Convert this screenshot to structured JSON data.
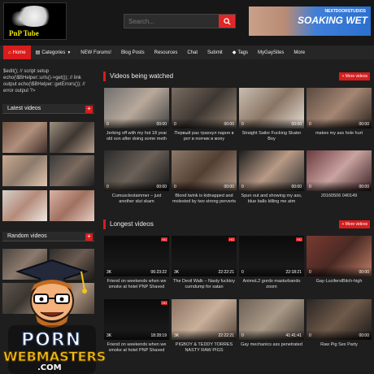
{
  "header": {
    "logo_text": "PnP Tube",
    "search_placeholder": "Search...",
    "banner_top": "NEXTDOORSTUDIOS",
    "banner_main": "SOAKING WET"
  },
  "nav": [
    {
      "label": "Home",
      "icon": "home-icon"
    },
    {
      "label": "Categories",
      "icon": "folder-icon"
    },
    {
      "label": "NEW Forums!"
    },
    {
      "label": "Blog Posts"
    },
    {
      "label": "Resources"
    },
    {
      "label": "Chat"
    },
    {
      "label": "Submit"
    },
    {
      "label": "Tags",
      "icon": "tag-icon"
    },
    {
      "label": "MyGaySites"
    },
    {
      "label": "More"
    }
  ],
  "sidebar": {
    "code_snippet": "$edit(); // script setup echo(\\$BHelper::urls()->get()); // link output echo(\\$BHelper::getErrors()); // error output ?>",
    "latest_title": "Latest videos",
    "random_title": "Random videos",
    "plus_label": "+"
  },
  "watching": {
    "title": "Videos being watched",
    "more_label": "+ More videos",
    "items": [
      {
        "title": "Jerking off with my hot 18 year old son after doing some meth",
        "views": "0",
        "duration": "00:00"
      },
      {
        "title": "Первый раз трахнул парня в рот в попчик в жопу",
        "views": "0",
        "duration": "00:00"
      },
      {
        "title": "Straight Sailor Fucking Skater Boy",
        "views": "0",
        "duration": "00:00"
      },
      {
        "title": "makes my ass hole hurt",
        "views": "0",
        "duration": "00:00"
      },
      {
        "title": "Cumusclestammer – just another slut skam",
        "views": "0",
        "duration": "00:00"
      },
      {
        "title": "Blond twink is kidnapped and molested by two strong perverts",
        "views": "0",
        "duration": "00:00"
      },
      {
        "title": "Spun out and showing my ass, blue balls killing me atm",
        "views": "0",
        "duration": "00:00"
      },
      {
        "title": "20160506 040149",
        "views": "0",
        "duration": "00:00"
      }
    ]
  },
  "longest": {
    "title": "Longest videos",
    "more_label": "+ More videos",
    "items": [
      {
        "title": "Friend on weekends when we smoke at hotel PNP Shaved Cock",
        "views": "3K",
        "duration": "06:23:22"
      },
      {
        "title": "The Devil Walk – Nasty fucktoy cumdump for satan",
        "views": "3K",
        "duration": "22:22:21"
      },
      {
        "title": "AnimoL2 gordo masturbando zoom",
        "views": "0",
        "duration": "22:18:21"
      },
      {
        "title": "Gay-LuciferslBitch-high",
        "views": "0",
        "duration": "00:00"
      },
      {
        "title": "Friend on weekends when we smoke at hotel PNP Shaved Cock",
        "views": "3K",
        "duration": "18:28:19"
      },
      {
        "title": "PIGBOY & TEDDY TORRES NASTY RAW PIGS",
        "views": "3K",
        "duration": "22:22:21"
      },
      {
        "title": "Gay mechanics ass penetrated",
        "views": "0",
        "duration": "41:41:41"
      },
      {
        "title": "Raw Pig Sex Party",
        "views": "0",
        "duration": "00:00"
      }
    ]
  },
  "overlay": {
    "line1": "PORN",
    "line2": "WEBMASTERS",
    "line3": ".COM"
  },
  "colors": {
    "accent": "#d91c1c",
    "background": "#1e1e1e",
    "logo_text": "#f3e600"
  }
}
